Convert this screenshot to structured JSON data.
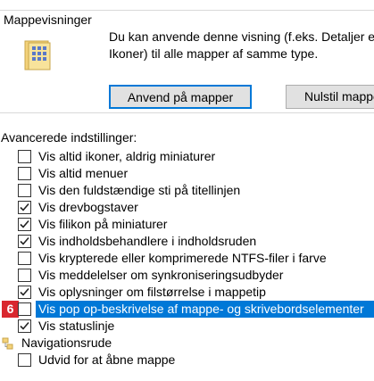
{
  "group": {
    "title": "Mappevisninger",
    "description": "Du kan anvende denne visning (f.eks. Detaljer eller\nIkoner) til alle mapper af samme type.",
    "apply_button": "Anvend på mapper",
    "reset_button": "Nulstil mapper"
  },
  "advanced": {
    "label": "Avancerede indstillinger:",
    "items": [
      {
        "label": "Vis altid ikoner, aldrig miniaturer",
        "checked": false
      },
      {
        "label": "Vis altid menuer",
        "checked": false
      },
      {
        "label": "Vis den fuldstændige sti på titellinjen",
        "checked": false
      },
      {
        "label": "Vis drevbogstaver",
        "checked": true
      },
      {
        "label": "Vis filikon på miniaturer",
        "checked": true
      },
      {
        "label": "Vis indholdsbehandlere i indholdsruden",
        "checked": true
      },
      {
        "label": "Vis krypterede eller komprimerede NTFS-filer i farve",
        "checked": false
      },
      {
        "label": "Vis meddelelser om synkroniseringsudbyder",
        "checked": false
      },
      {
        "label": "Vis oplysninger om filstørrelse i mappetip",
        "checked": true
      },
      {
        "label": "Vis pop op-beskrivelse af mappe- og skrivebordselementer",
        "checked": false,
        "selected": true
      },
      {
        "label": "Vis statuslinje",
        "checked": true
      }
    ],
    "nav_group": "Navigationsrude",
    "nav_items": [
      {
        "label": "Udvid for at åbne mappe",
        "checked": false
      }
    ]
  },
  "badge": "6",
  "colors": {
    "accent": "#0078d7",
    "badge": "#d9272e"
  }
}
